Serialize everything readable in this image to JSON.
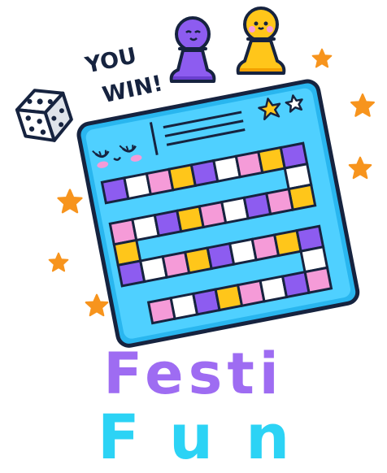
{
  "badge": {
    "line1": "YOU",
    "line2": "WIN!"
  },
  "title": {
    "line1": "Festi",
    "line2": "Fun"
  },
  "colors": {
    "outline": "#16233f",
    "board_blue": "#29b6ef",
    "board_light": "#4fd0ff",
    "purple": "#8d5cf0",
    "pink": "#f59bd8",
    "yellow": "#ffc61a",
    "star_orange": "#f7941d",
    "title_purple": "#9e6cf2",
    "title_cyan": "#2cd3f5"
  },
  "icons": [
    "dice-icon",
    "purple-pawn-icon",
    "yellow-pawn-icon",
    "star-icon",
    "board-game-icon"
  ]
}
